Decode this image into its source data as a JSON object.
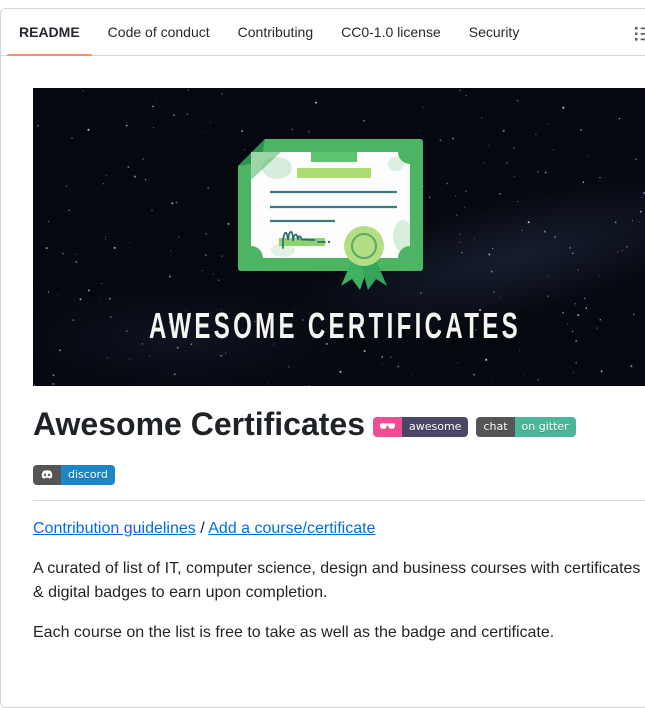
{
  "colors": {
    "accent_underline": "#fd8c73",
    "border": "#d0d7de",
    "link_blue": "#0969da",
    "text": "#1f2328",
    "icon_gray": "#59626b"
  },
  "tab_bar": {
    "tabs": [
      {
        "label": "README",
        "active": true
      },
      {
        "label": "Code of conduct",
        "active": false
      },
      {
        "label": "Contributing",
        "active": false
      },
      {
        "label": "CC0-1.0 license",
        "active": false
      },
      {
        "label": "Security",
        "active": false
      }
    ],
    "outline_icon": "list-outline-icon"
  },
  "hero": {
    "caption_text": "AWESOME CERTIFICATES",
    "bg_color": "#06080f",
    "frame_green": "#4db463",
    "light_green": "#abdc72",
    "bar_green": "#5cc46f",
    "rosette_green": "#b3de85",
    "ribbon_green": "#3eb260",
    "line_teal": "#3e7a80",
    "signature_teal": "#2b6b76",
    "caption_color": "#f4f4f1"
  },
  "article": {
    "title": "Awesome Certificates",
    "badges": [
      {
        "name": "awesome",
        "left_label": "",
        "right_label": "awesome",
        "left_color": "#ef4d94",
        "right_color": "#4a4668",
        "icon": "sunglasses-icon"
      },
      {
        "name": "gitter",
        "left_label": "chat",
        "right_label": "on gitter",
        "left_color": "#555555",
        "right_color": "#4ab79a",
        "icon": ""
      },
      {
        "name": "discord",
        "left_label": "",
        "right_label": "discord",
        "left_color": "#555555",
        "right_color": "#1d86c8",
        "icon": "discord-icon"
      }
    ],
    "links": {
      "contribution": "Contribution guidelines",
      "separator": "/",
      "add_course": "Add a course/certificate"
    },
    "paragraphs": [
      "A curated of list of IT, computer science, design and business courses with certificates & digital badges to earn upon completion.",
      "Each course on the list is free to take as well as the badge and certificate."
    ]
  }
}
